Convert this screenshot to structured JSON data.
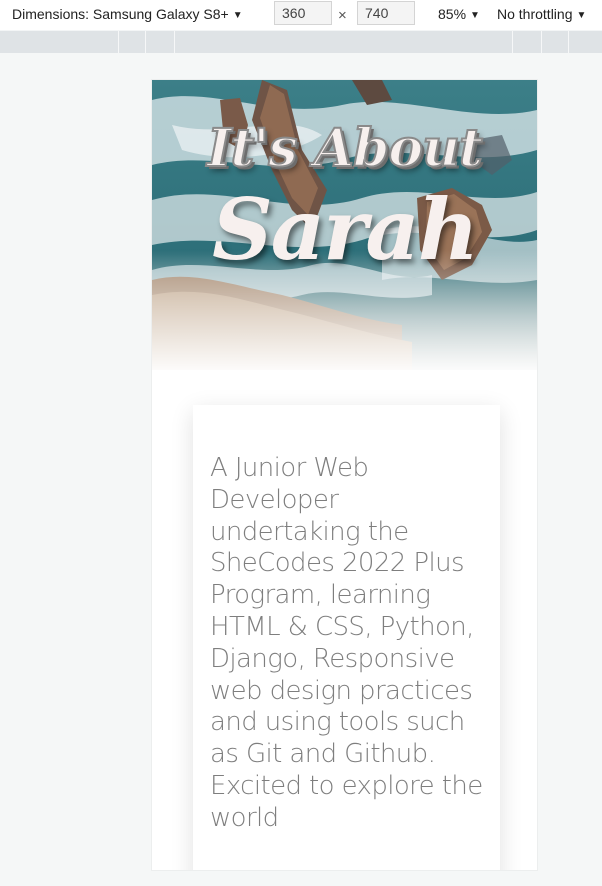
{
  "devtools": {
    "dimensions_label": "Dimensions: Samsung Galaxy S8+",
    "width": "360",
    "height": "740",
    "times": "×",
    "zoom": "85%",
    "throttling": "No throttling",
    "caret": "▼"
  },
  "page": {
    "hero": {
      "title_line1": "It's About",
      "title_line2": "Sarah"
    },
    "intro": "A Junior Web Developer undertaking the SheCodes 2022 Plus Program, learning HTML & CSS, Python, Django, Responsive web design practices and using tools such as Git and Github. Excited to explore the world"
  },
  "colors": {
    "page_background": "#f5f7f7",
    "text_gray": "#7e7e7e",
    "title_white": "#f7f0ee",
    "ocean_teal": "#2b6f79"
  }
}
